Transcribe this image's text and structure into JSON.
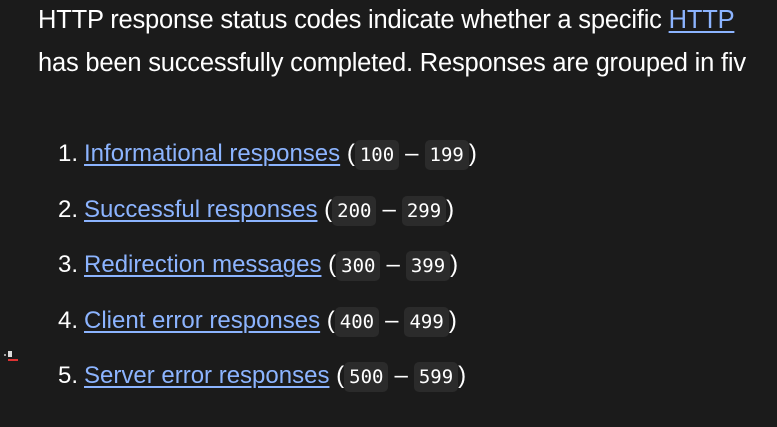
{
  "intro": {
    "line1_text": "HTTP response status codes indicate whether a specific ",
    "line1_link": "HTTP",
    "line2_text": "has been successfully completed. Responses are grouped in fiv"
  },
  "list": [
    {
      "num": "1.",
      "label": "Informational responses",
      "from": "100",
      "to": "199"
    },
    {
      "num": "2.",
      "label": "Successful responses",
      "from": "200",
      "to": "299"
    },
    {
      "num": "3.",
      "label": "Redirection messages",
      "from": "300",
      "to": "399"
    },
    {
      "num": "4.",
      "label": "Client error responses",
      "from": "400",
      "to": "499"
    },
    {
      "num": "5.",
      "label": "Server error responses",
      "from": "500",
      "to": "599"
    }
  ],
  "punct": {
    "open": "(",
    "close": ")",
    "dash": "–"
  },
  "colors": {
    "background": "#1b1b1b",
    "link": "#8cb4ff",
    "code_bg": "#2b2b2b"
  }
}
